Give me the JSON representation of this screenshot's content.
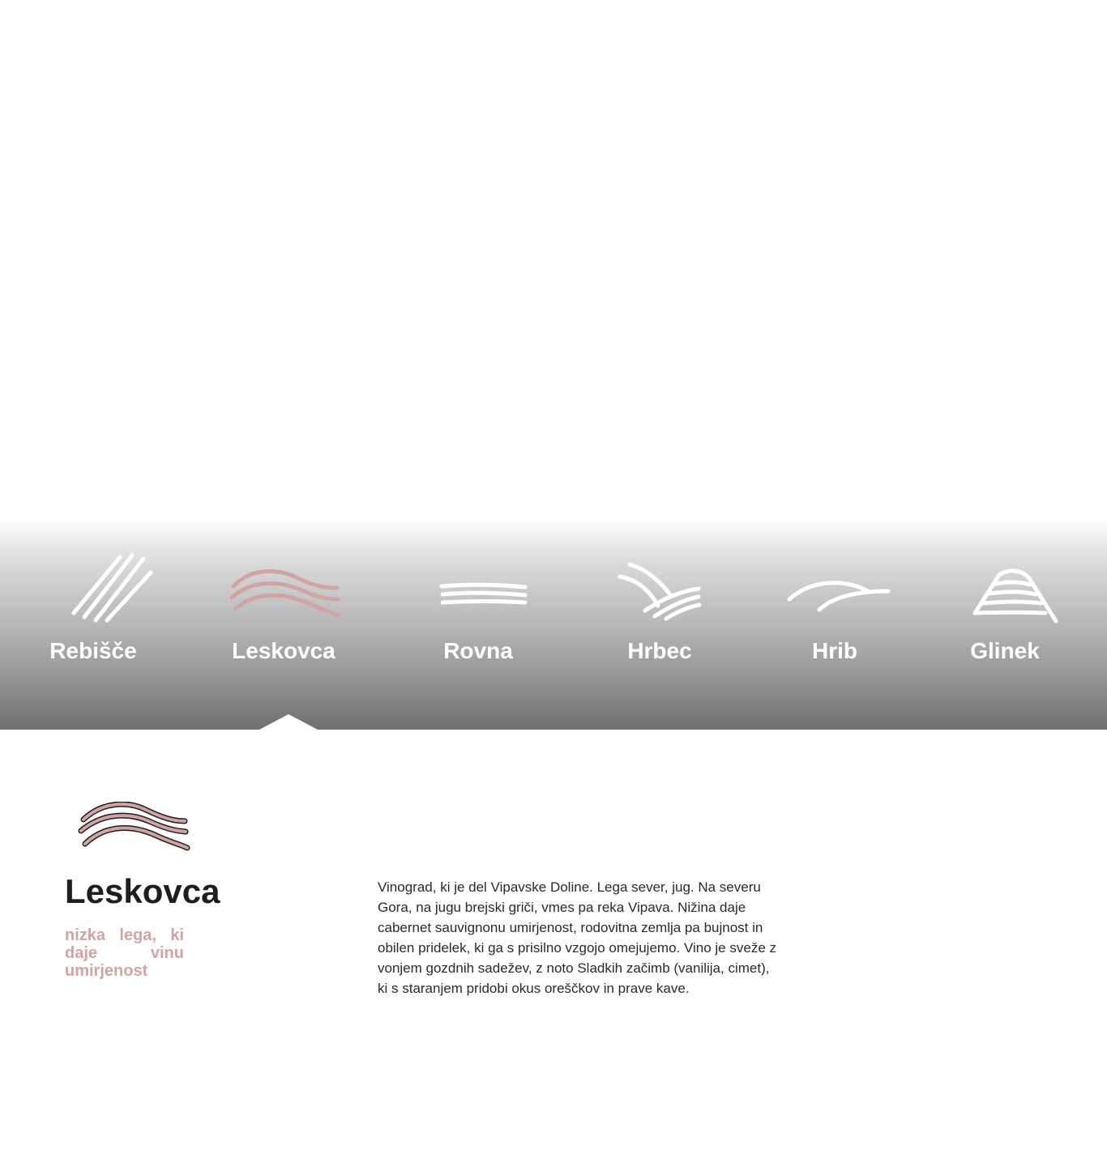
{
  "colors": {
    "accent": "#d1a4a2",
    "tab_text": "#ffffff",
    "title": "#1e1e1e",
    "body_text": "#2a2a2a"
  },
  "tabs": [
    {
      "label": "Rebišče",
      "icon": "diagonal-lines-icon",
      "active": false
    },
    {
      "label": "Leskovca",
      "icon": "wave-lines-icon",
      "active": true
    },
    {
      "label": "Rovna",
      "icon": "flat-lines-icon",
      "active": false
    },
    {
      "label": "Hrbec",
      "icon": "crossing-lines-icon",
      "active": false
    },
    {
      "label": "Hrib",
      "icon": "hill-curve-icon",
      "active": false
    },
    {
      "label": "Glinek",
      "icon": "fan-shape-icon",
      "active": false
    }
  ],
  "detail": {
    "icon": "wave-lines-icon",
    "title": "Leskovca",
    "tagline": "nizka lega, ki daje vinu umirjenost",
    "description": "Vinograd, ki je del Vipavske Doline. Lega sever, jug. Na severu Gora, na jugu brejski griči, vmes pa reka Vipava. Nižina daje cabernet sauvignonu umirjenost, rodovitna zemlja pa bujnost in obilen pridelek, ki ga s prisilno vzgojo omejujemo. Vino je sveže z vonjem gozdnih sadežev, z noto Sladkih začimb (vanilija, cimet), ki s staranjem pridobi okus oreščkov in prave kave."
  }
}
